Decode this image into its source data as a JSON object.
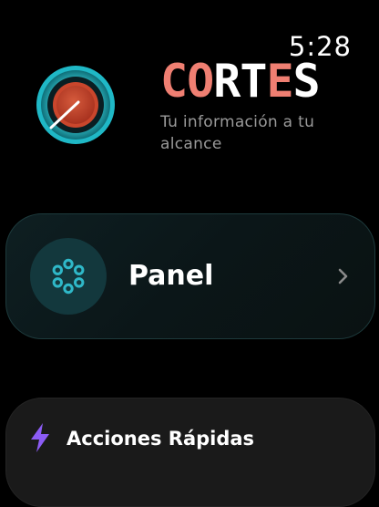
{
  "status_bar": {
    "time": "5:28"
  },
  "header": {
    "logo_icon": "target-dial-icon",
    "brand_segments": [
      {
        "text": "CO",
        "color": "#ef7f72"
      },
      {
        "text": "RT",
        "color": "#ffffff"
      },
      {
        "text": "E",
        "color": "#ef7f72"
      },
      {
        "text": "S",
        "color": "#ffffff"
      }
    ],
    "tagline": "Tu información a tu alcance"
  },
  "menu": {
    "panel": {
      "label": "Panel",
      "icon": "dots-ring-icon",
      "accent_color": "#2fb8c8"
    },
    "quick_actions": {
      "label": "Acciones Rápidas",
      "icon": "lightning-icon",
      "accent_color": "#8c5cf5"
    }
  }
}
